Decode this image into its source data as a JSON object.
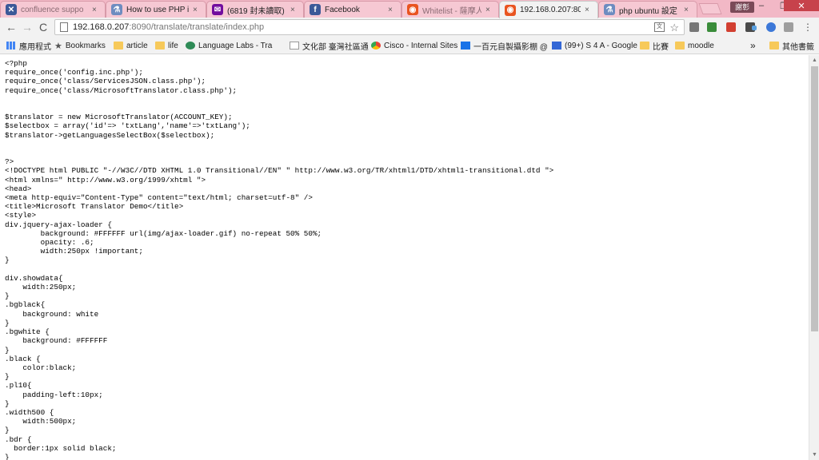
{
  "tabs": [
    {
      "title": "confluence suppo",
      "icon": "atlassian-icon",
      "color": "#3b5998",
      "glyph": "✕"
    },
    {
      "title": "How to use PHP i",
      "icon": "stackexchange-icon",
      "color": "#6e8cc0",
      "glyph": "⚗"
    },
    {
      "title": "(6819 封未讀取) - Y",
      "icon": "mail-icon",
      "color": "#720e9e",
      "glyph": "✉"
    },
    {
      "title": "Facebook",
      "icon": "facebook-icon",
      "color": "#3b5998",
      "glyph": "f"
    },
    {
      "title": "Whitelist - 薩摩人",
      "icon": "ubuntu-icon",
      "color": "#e95420",
      "glyph": "◉"
    },
    {
      "title": "192.168.0.207:809",
      "icon": "ubuntu-icon",
      "color": "#e95420",
      "glyph": "◉"
    },
    {
      "title": "php ubuntu 設定",
      "icon": "stackexchange-icon",
      "color": "#6e8cc0",
      "glyph": "⚗"
    }
  ],
  "tab_close": "×",
  "user_name": "謝彰",
  "window": {
    "minimize": "–",
    "restore": "❐",
    "close": "✕"
  },
  "nav": {
    "back": "←",
    "forward": "→",
    "reload": "C"
  },
  "omnibox": {
    "host": "192.168.0.207",
    "rest": ":8090/translate/translate/index.php",
    "translate": "文",
    "star": "☆"
  },
  "extensions": [
    {
      "color": "#777777"
    },
    {
      "color": "#3a8c3a"
    },
    {
      "color": "#d23f31"
    },
    {
      "color": "#4a4a4a"
    },
    {
      "color": "#5aa0e0"
    },
    {
      "color": "#3c78d8"
    },
    {
      "color": "#9e9e9e"
    },
    {
      "color": "#777777"
    }
  ],
  "bookmarks": [
    {
      "label": "應用程式",
      "icon": "apps-icon",
      "color": "#4285f4"
    },
    {
      "label": "Bookmarks",
      "icon": "star-icon",
      "color": "#555555"
    },
    {
      "label": "article",
      "icon": "folder-icon",
      "color": "#f7c95a"
    },
    {
      "label": "life",
      "icon": "folder-icon",
      "color": "#f7c95a"
    },
    {
      "label": "Language Labs - Tra",
      "icon": "site-icon",
      "color": "#2e8b57"
    },
    {
      "label": "文化部 臺灣社區通",
      "icon": "page-icon",
      "color": "#bbbbbb"
    },
    {
      "label": "Cisco - Internal Sites",
      "icon": "chrome-icon",
      "color": "#34a853"
    },
    {
      "label": "一百元自製攝影棚 @",
      "icon": "site-icon",
      "color": "#1a73e8"
    },
    {
      "label": "(99+) S 4 A - Google",
      "icon": "site-icon",
      "color": "#3367d6"
    },
    {
      "label": "比賽",
      "icon": "folder-icon",
      "color": "#f7c95a"
    },
    {
      "label": "moodle",
      "icon": "folder-icon",
      "color": "#f7c95a"
    },
    {
      "label": "»",
      "icon": "more-icon",
      "color": "#555555"
    },
    {
      "label": "其他書籤",
      "icon": "folder-icon",
      "color": "#f7c95a"
    }
  ],
  "source_lines": [
    "<?php",
    "require_once('config.inc.php');",
    "require_once('class/ServicesJSON.class.php');",
    "require_once('class/MicrosoftTranslator.class.php');",
    "",
    "",
    "$translator = new MicrosoftTranslator(ACCOUNT_KEY);",
    "$selectbox = array('id'=> 'txtLang','name'=>'txtLang');",
    "$translator->getLanguagesSelectBox($selectbox);",
    "",
    "",
    "?>",
    "<!DOCTYPE html PUBLIC \"-//W3C//DTD XHTML 1.0 Transitional//EN\" \" http://www.w3.org/TR/xhtml1/DTD/xhtml1-transitional.dtd \">",
    "<html xmlns=\" http://www.w3.org/1999/xhtml \">",
    "<head>",
    "<meta http-equiv=\"Content-Type\" content=\"text/html; charset=utf-8\" />",
    "<title>Microsoft Translator Demo</title>",
    "<style>",
    "div.jquery-ajax-loader {",
    "        background: #FFFFFF url(img/ajax-loader.gif) no-repeat 50% 50%;",
    "        opacity: .6;",
    "        width:250px !important;",
    "}",
    "",
    "div.showdata{",
    "    width:250px;",
    "}",
    ".bgblack{",
    "    background: white",
    "}",
    ".bgwhite {",
    "    background: #FFFFFF",
    "}",
    ".black {",
    "    color:black;",
    "}",
    ".pl10{",
    "    padding-left:10px;",
    "}",
    ".width500 {",
    "    width:500px;",
    "}",
    ".bdr {",
    "  border:1px solid black;",
    "}"
  ],
  "scrollbar": {
    "up": "▲",
    "down": "▼"
  }
}
